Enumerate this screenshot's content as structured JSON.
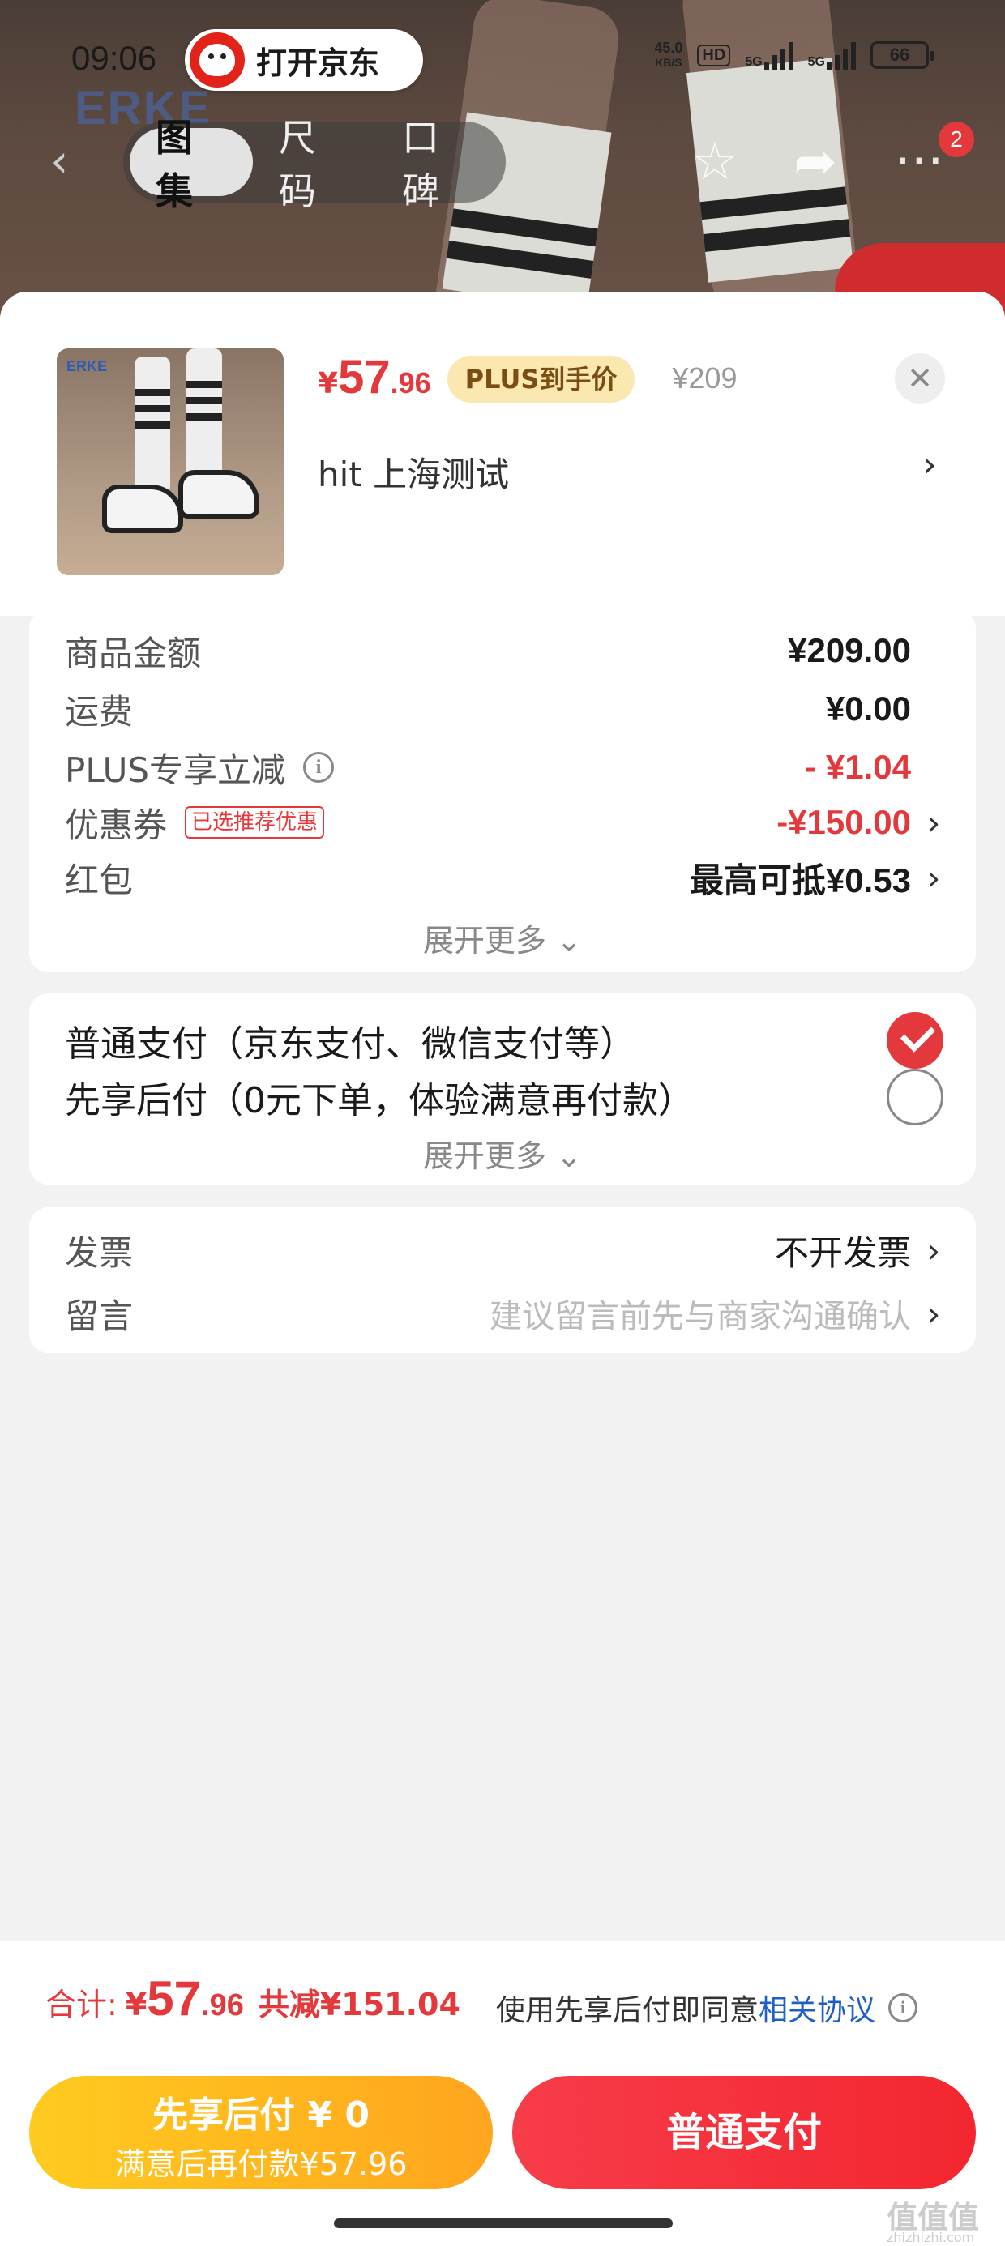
{
  "status_bar": {
    "time": "09:06",
    "net_speed": "45.0",
    "net_unit": "KB/S",
    "hd": "HD",
    "sig1": "5G",
    "sig2": "5G",
    "battery": "66"
  },
  "top_nav": {
    "open_app_label": "打开京东",
    "brand_watermark": "ERKE",
    "tabs": [
      {
        "label": "图集",
        "active": true
      },
      {
        "label": "尺码",
        "active": false
      },
      {
        "label": "口碑",
        "active": false
      }
    ],
    "notif_count": "2"
  },
  "product": {
    "currency": "¥",
    "price_int": "57",
    "price_dec": ".96",
    "plus_badge": "PLUS到手价",
    "orig_price": "¥209",
    "address": "hit  上海测试",
    "thumb_logo": "ERKE"
  },
  "summary": {
    "rows": [
      {
        "label": "商品金额",
        "value": "¥209.00"
      },
      {
        "label": "运费",
        "value": "¥0.00"
      },
      {
        "label": "PLUS专享立减",
        "value": "- ¥1.04"
      },
      {
        "label": "优惠券",
        "tag": "已选推荐优惠",
        "value": "-¥150.00"
      },
      {
        "label": "红包",
        "value": "最高可抵¥0.53"
      }
    ],
    "expand_label": "展开更多 ⌄"
  },
  "payment": {
    "options": [
      {
        "label": "普通支付（京东支付、微信支付等）",
        "selected": true
      },
      {
        "label": "先享后付（0元下单，体验满意再付款）",
        "selected": false
      }
    ],
    "expand_label": "展开更多 ⌄"
  },
  "extras": {
    "invoice_label": "发票",
    "invoice_value": "不开发票",
    "note_label": "留言",
    "note_placeholder": "建议留言前先与商家沟通确认"
  },
  "bottom_bar": {
    "total_label": "合计:",
    "currency": "¥",
    "total_int": "57",
    "total_dec": ".96",
    "saved": "共减¥151.04",
    "agree_prefix": "使用先享后付即同意",
    "agree_link": "相关协议",
    "bnpl_line1": "先享后付 ¥ 0",
    "bnpl_line2": "满意后再付款¥57.96",
    "pay_label": "普通支付",
    "watermark": "值值值",
    "watermark_url": "zhizhizhi.com"
  },
  "colors": {
    "accent_red": "#e4393c",
    "plus_gold": "#fbe7b0",
    "bnpl_yellow": "#ffb41f",
    "link_blue": "#1f5fc6"
  }
}
